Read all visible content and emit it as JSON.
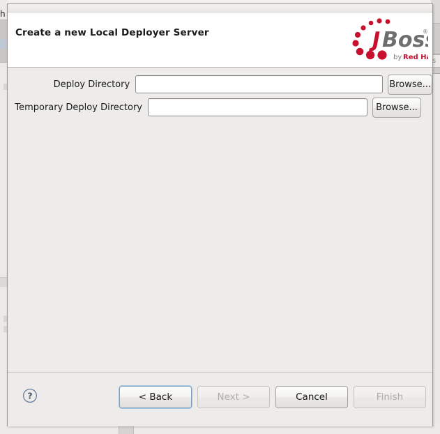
{
  "background": {
    "left_tab_text": "h",
    "right_label": "s"
  },
  "dialog": {
    "header": {
      "title": "Create a new Local Deployer Server",
      "logo": {
        "name": "jboss-logo",
        "wordmark_j": "J",
        "wordmark_boss": "Boss",
        "registered_mark": "®",
        "byline_prefix": "by ",
        "byline_brand": "Red Hat",
        "dot_color": "#c8102e",
        "j_color": "#c8102e",
        "boss_color": "#6e6e6e",
        "byline_color": "#7a7a7a",
        "brand_color": "#c8102e"
      }
    },
    "form": {
      "fields": [
        {
          "label": "Deploy Directory",
          "value": "",
          "placeholder": "",
          "browse_label": "Browse..."
        },
        {
          "label": "Temporary Deploy Directory",
          "value": "",
          "placeholder": "",
          "browse_label": "Browse..."
        }
      ]
    },
    "footer": {
      "help_glyph": "?",
      "buttons": [
        {
          "label": "< Back",
          "enabled": true,
          "focused": true
        },
        {
          "label": "Next >",
          "enabled": false,
          "focused": false
        },
        {
          "label": "Cancel",
          "enabled": true,
          "focused": false
        },
        {
          "label": "Finish",
          "enabled": false,
          "focused": false
        }
      ]
    }
  }
}
